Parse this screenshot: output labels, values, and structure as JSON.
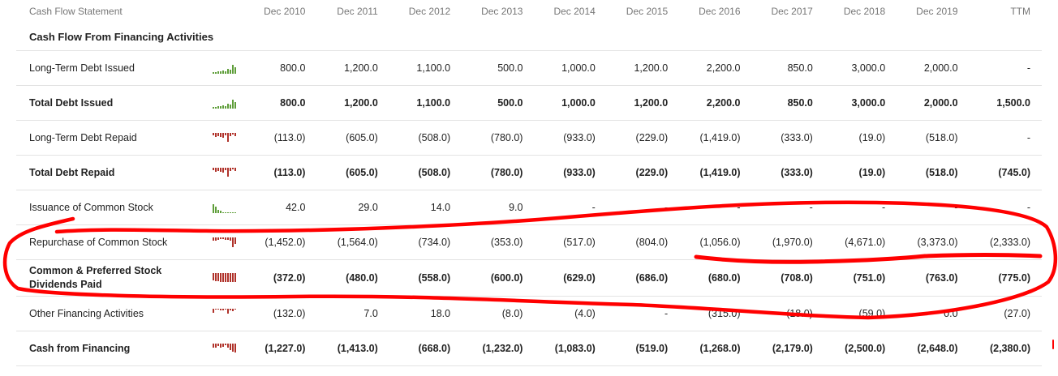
{
  "header": {
    "title": "Cash Flow Statement",
    "periods": [
      "Dec 2010",
      "Dec 2011",
      "Dec 2012",
      "Dec 2013",
      "Dec 2014",
      "Dec 2015",
      "Dec 2016",
      "Dec 2017",
      "Dec 2018",
      "Dec 2019",
      "TTM"
    ]
  },
  "section": {
    "title": "Cash Flow From Financing Activities"
  },
  "rows": [
    {
      "label": "Long-Term Debt Issued",
      "bold": false,
      "values": [
        "800.0",
        "1,200.0",
        "1,100.0",
        "500.0",
        "1,000.0",
        "1,200.0",
        "2,200.0",
        "850.0",
        "3,000.0",
        "2,000.0",
        "-"
      ]
    },
    {
      "label": "Total Debt Issued",
      "bold": true,
      "values": [
        "800.0",
        "1,200.0",
        "1,100.0",
        "500.0",
        "1,000.0",
        "1,200.0",
        "2,200.0",
        "850.0",
        "3,000.0",
        "2,000.0",
        "1,500.0"
      ]
    },
    {
      "label": "Long-Term Debt Repaid",
      "bold": false,
      "values": [
        "(113.0)",
        "(605.0)",
        "(508.0)",
        "(780.0)",
        "(933.0)",
        "(229.0)",
        "(1,419.0)",
        "(333.0)",
        "(19.0)",
        "(518.0)",
        "-"
      ]
    },
    {
      "label": "Total Debt Repaid",
      "bold": true,
      "values": [
        "(113.0)",
        "(605.0)",
        "(508.0)",
        "(780.0)",
        "(933.0)",
        "(229.0)",
        "(1,419.0)",
        "(333.0)",
        "(19.0)",
        "(518.0)",
        "(745.0)"
      ]
    },
    {
      "label": "Issuance of Common Stock",
      "bold": false,
      "values": [
        "42.0",
        "29.0",
        "14.0",
        "9.0",
        "-",
        "-",
        "-",
        "-",
        "-",
        "-",
        "-"
      ]
    },
    {
      "label": "Repurchase of Common Stock",
      "bold": false,
      "values": [
        "(1,452.0)",
        "(1,564.0)",
        "(734.0)",
        "(353.0)",
        "(517.0)",
        "(804.0)",
        "(1,056.0)",
        "(1,970.0)",
        "(4,671.0)",
        "(3,373.0)",
        "(2,333.0)"
      ]
    },
    {
      "label": "Common & Preferred Stock Dividends Paid",
      "bold": true,
      "values": [
        "(372.0)",
        "(480.0)",
        "(558.0)",
        "(600.0)",
        "(629.0)",
        "(686.0)",
        "(680.0)",
        "(708.0)",
        "(751.0)",
        "(763.0)",
        "(775.0)"
      ]
    },
    {
      "label": "Other Financing Activities",
      "bold": false,
      "values": [
        "(132.0)",
        "7.0",
        "18.0",
        "(8.0)",
        "(4.0)",
        "-",
        "(315.0)",
        "(18.0)",
        "(59.0)",
        "0.0",
        "(27.0)"
      ]
    },
    {
      "label": "Cash from Financing",
      "bold": true,
      "values": [
        "(1,227.0)",
        "(1,413.0)",
        "(668.0)",
        "(1,232.0)",
        "(1,083.0)",
        "(519.0)",
        "(1,268.0)",
        "(2,179.0)",
        "(2,500.0)",
        "(2,648.0)",
        "(2,380.0)"
      ]
    }
  ],
  "colors": {
    "positive_spark": "#5f9e3a",
    "negative_spark": "#b0322a",
    "annotation": "#ff0000"
  }
}
